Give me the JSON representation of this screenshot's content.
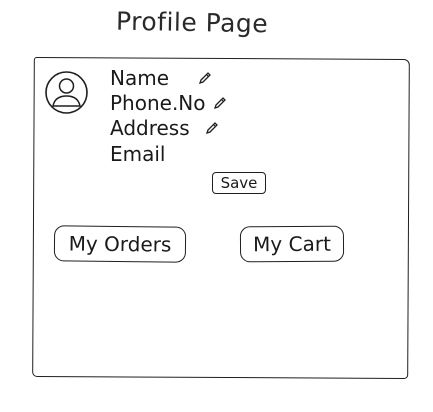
{
  "header": {
    "title": "Profile Page"
  },
  "profile": {
    "avatar_icon": "user-avatar-icon",
    "fields": [
      {
        "label": "Name",
        "icon": "pencil-icon"
      },
      {
        "label": "Phone.No",
        "icon": "pencil-icon"
      },
      {
        "label": "Address",
        "icon": "pencil-icon"
      },
      {
        "label": "Email"
      }
    ]
  },
  "actions": {
    "save_label": "Save",
    "orders_label": "My Orders",
    "cart_label": "My Cart"
  }
}
